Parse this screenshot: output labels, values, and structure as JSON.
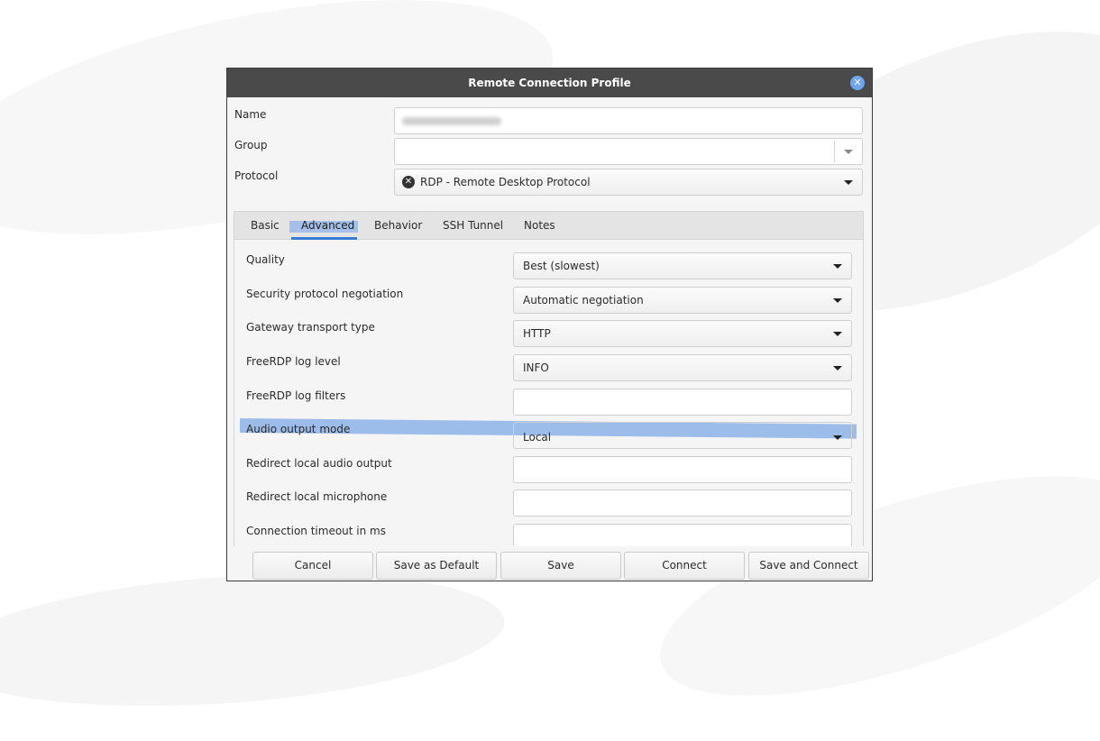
{
  "dialog": {
    "title": "Remote Connection Profile",
    "close_icon": "close-icon"
  },
  "form": {
    "name_label": "Name",
    "name_value": "",
    "group_label": "Group",
    "group_value": "",
    "protocol_label": "Protocol",
    "protocol_value": "RDP - Remote Desktop Protocol"
  },
  "tabs": [
    {
      "label": "Basic"
    },
    {
      "label": "Advanced"
    },
    {
      "label": "Behavior"
    },
    {
      "label": "SSH Tunnel"
    },
    {
      "label": "Notes"
    }
  ],
  "advanced": {
    "rows": [
      {
        "label": "Quality",
        "value": "Best (slowest)",
        "type": "combo"
      },
      {
        "label": "Security protocol negotiation",
        "value": "Automatic negotiation",
        "type": "combo"
      },
      {
        "label": "Gateway transport type",
        "value": "HTTP",
        "type": "combo"
      },
      {
        "label": "FreeRDP log level",
        "value": "INFO",
        "type": "combo"
      },
      {
        "label": "FreeRDP log filters",
        "value": "",
        "type": "entry"
      },
      {
        "label": "Audio output mode",
        "value": "Local",
        "type": "combo"
      },
      {
        "label": "Redirect local audio output",
        "value": "",
        "type": "entry"
      },
      {
        "label": "Redirect local microphone",
        "value": "",
        "type": "entry"
      },
      {
        "label": "Connection timeout in ms",
        "value": "",
        "type": "entry"
      }
    ]
  },
  "buttons": {
    "cancel": "Cancel",
    "save_default": "Save as Default",
    "save": "Save",
    "connect": "Connect",
    "save_connect": "Save and Connect"
  },
  "colors": {
    "titlebar": "#4a4a4a",
    "accent": "#3a7bd5",
    "highlight": "#7ea9e6"
  }
}
